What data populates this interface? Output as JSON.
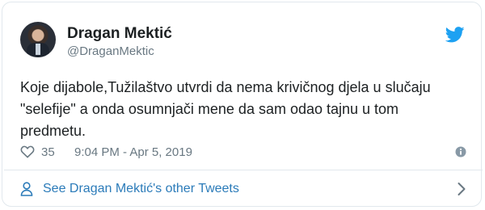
{
  "user": {
    "name": "Dragan Mektić",
    "handle": "@DraganMektic"
  },
  "tweet": {
    "text": "Koje dijabole,Tužilaštvo utvrdi da nema krivičnog djela u slučaju\n\"selefije\" a onda osumnjači mene da sam odao tajnu u tom\npredmetu."
  },
  "meta": {
    "likes": "35",
    "timestamp": "9:04 PM - Apr 5, 2019"
  },
  "footer": {
    "link_label": "See Dragan Mektić's other Tweets"
  },
  "colors": {
    "twitter_blue": "#1da1f2",
    "link_blue": "#2b7bb9",
    "meta_gray": "#697882"
  },
  "icons": [
    "twitter-bird-icon",
    "heart-icon",
    "info-icon",
    "person-icon",
    "chevron-right-icon"
  ]
}
